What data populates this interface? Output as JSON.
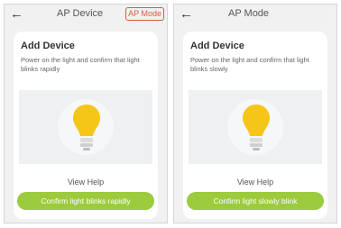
{
  "colors": {
    "accent_green": "#9ccb3d",
    "bulb_yellow": "#f5c518",
    "highlight_red": "#e2563a"
  },
  "left_screen": {
    "back_icon": "←",
    "title": "AP Device",
    "mode_link": "AP Mode",
    "card_title": "Add Device",
    "description": "Power on the light and confirm that light blinks rapidly",
    "illustration_icon": "light-bulb-icon",
    "view_help": "View Help",
    "confirm_button": "Confirm light blinks rapidly"
  },
  "right_screen": {
    "back_icon": "←",
    "title": "AP Mode",
    "card_title": "Add Device",
    "description": "Power on the light and confirm that light blinks slowly",
    "illustration_icon": "light-bulb-icon",
    "view_help": "View Help",
    "confirm_button": "Confirm light slowly blink"
  }
}
